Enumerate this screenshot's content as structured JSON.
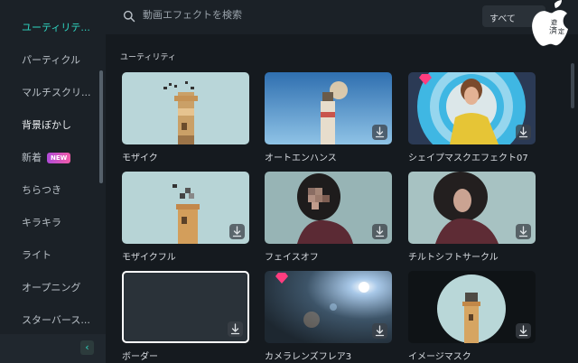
{
  "sidebar": {
    "items": [
      {
        "label": "ユーティリテ..."
      },
      {
        "label": "パーティクル"
      },
      {
        "label": "マルチスクリ..."
      },
      {
        "label": "背景ぼかし"
      },
      {
        "label": "新着"
      },
      {
        "label": "ちらつき"
      },
      {
        "label": "キラキラ"
      },
      {
        "label": "ライト"
      },
      {
        "label": "オープニング"
      },
      {
        "label": "スターバース..."
      }
    ],
    "new_badge": "NEW",
    "collapse_glyph": "‹"
  },
  "search": {
    "placeholder": "動画エフェクトを検索"
  },
  "filter": {
    "selected": "すべて"
  },
  "watermark": {
    "text_line1": "遊",
    "text_line2": "済",
    "text_line3": "定"
  },
  "section": {
    "title": "ユーティリティ"
  },
  "effects": [
    {
      "label": "モザイク",
      "premium": false,
      "download": false
    },
    {
      "label": "オートエンハンス",
      "premium": false,
      "download": true
    },
    {
      "label": "シェイプマスクエフェクト07",
      "premium": true,
      "download": true
    },
    {
      "label": "モザイクフル",
      "premium": false,
      "download": true
    },
    {
      "label": "フェイスオフ",
      "premium": false,
      "download": true
    },
    {
      "label": "チルトシフトサークル",
      "premium": false,
      "download": true
    },
    {
      "label": "ボーダー",
      "premium": false,
      "download": true
    },
    {
      "label": "カメラレンズフレア3",
      "premium": true,
      "download": true
    },
    {
      "label": "イメージマスク",
      "premium": false,
      "download": true
    }
  ],
  "colors": {
    "accent": "#2fd6c2",
    "background": "#151a1f",
    "panel": "#1b2127"
  }
}
